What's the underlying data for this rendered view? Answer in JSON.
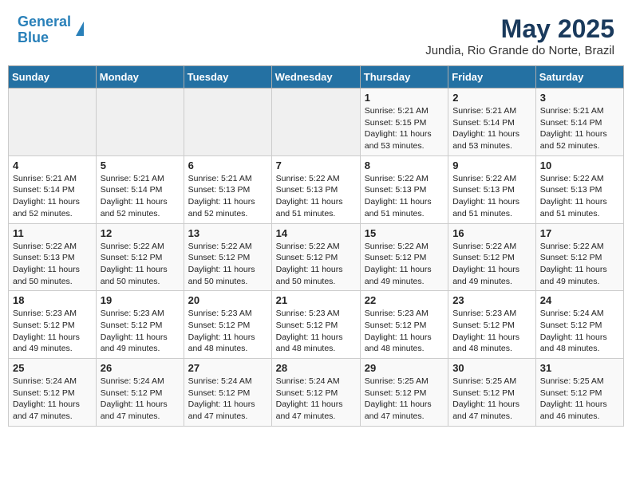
{
  "header": {
    "logo_line1": "General",
    "logo_line2": "Blue",
    "title": "May 2025",
    "subtitle": "Jundia, Rio Grande do Norte, Brazil"
  },
  "calendar": {
    "days_of_week": [
      "Sunday",
      "Monday",
      "Tuesday",
      "Wednesday",
      "Thursday",
      "Friday",
      "Saturday"
    ],
    "weeks": [
      [
        {
          "day": "",
          "info": ""
        },
        {
          "day": "",
          "info": ""
        },
        {
          "day": "",
          "info": ""
        },
        {
          "day": "",
          "info": ""
        },
        {
          "day": "1",
          "info": "Sunrise: 5:21 AM\nSunset: 5:15 PM\nDaylight: 11 hours\nand 53 minutes."
        },
        {
          "day": "2",
          "info": "Sunrise: 5:21 AM\nSunset: 5:14 PM\nDaylight: 11 hours\nand 53 minutes."
        },
        {
          "day": "3",
          "info": "Sunrise: 5:21 AM\nSunset: 5:14 PM\nDaylight: 11 hours\nand 52 minutes."
        }
      ],
      [
        {
          "day": "4",
          "info": "Sunrise: 5:21 AM\nSunset: 5:14 PM\nDaylight: 11 hours\nand 52 minutes."
        },
        {
          "day": "5",
          "info": "Sunrise: 5:21 AM\nSunset: 5:14 PM\nDaylight: 11 hours\nand 52 minutes."
        },
        {
          "day": "6",
          "info": "Sunrise: 5:21 AM\nSunset: 5:13 PM\nDaylight: 11 hours\nand 52 minutes."
        },
        {
          "day": "7",
          "info": "Sunrise: 5:22 AM\nSunset: 5:13 PM\nDaylight: 11 hours\nand 51 minutes."
        },
        {
          "day": "8",
          "info": "Sunrise: 5:22 AM\nSunset: 5:13 PM\nDaylight: 11 hours\nand 51 minutes."
        },
        {
          "day": "9",
          "info": "Sunrise: 5:22 AM\nSunset: 5:13 PM\nDaylight: 11 hours\nand 51 minutes."
        },
        {
          "day": "10",
          "info": "Sunrise: 5:22 AM\nSunset: 5:13 PM\nDaylight: 11 hours\nand 51 minutes."
        }
      ],
      [
        {
          "day": "11",
          "info": "Sunrise: 5:22 AM\nSunset: 5:13 PM\nDaylight: 11 hours\nand 50 minutes."
        },
        {
          "day": "12",
          "info": "Sunrise: 5:22 AM\nSunset: 5:12 PM\nDaylight: 11 hours\nand 50 minutes."
        },
        {
          "day": "13",
          "info": "Sunrise: 5:22 AM\nSunset: 5:12 PM\nDaylight: 11 hours\nand 50 minutes."
        },
        {
          "day": "14",
          "info": "Sunrise: 5:22 AM\nSunset: 5:12 PM\nDaylight: 11 hours\nand 50 minutes."
        },
        {
          "day": "15",
          "info": "Sunrise: 5:22 AM\nSunset: 5:12 PM\nDaylight: 11 hours\nand 49 minutes."
        },
        {
          "day": "16",
          "info": "Sunrise: 5:22 AM\nSunset: 5:12 PM\nDaylight: 11 hours\nand 49 minutes."
        },
        {
          "day": "17",
          "info": "Sunrise: 5:22 AM\nSunset: 5:12 PM\nDaylight: 11 hours\nand 49 minutes."
        }
      ],
      [
        {
          "day": "18",
          "info": "Sunrise: 5:23 AM\nSunset: 5:12 PM\nDaylight: 11 hours\nand 49 minutes."
        },
        {
          "day": "19",
          "info": "Sunrise: 5:23 AM\nSunset: 5:12 PM\nDaylight: 11 hours\nand 49 minutes."
        },
        {
          "day": "20",
          "info": "Sunrise: 5:23 AM\nSunset: 5:12 PM\nDaylight: 11 hours\nand 48 minutes."
        },
        {
          "day": "21",
          "info": "Sunrise: 5:23 AM\nSunset: 5:12 PM\nDaylight: 11 hours\nand 48 minutes."
        },
        {
          "day": "22",
          "info": "Sunrise: 5:23 AM\nSunset: 5:12 PM\nDaylight: 11 hours\nand 48 minutes."
        },
        {
          "day": "23",
          "info": "Sunrise: 5:23 AM\nSunset: 5:12 PM\nDaylight: 11 hours\nand 48 minutes."
        },
        {
          "day": "24",
          "info": "Sunrise: 5:24 AM\nSunset: 5:12 PM\nDaylight: 11 hours\nand 48 minutes."
        }
      ],
      [
        {
          "day": "25",
          "info": "Sunrise: 5:24 AM\nSunset: 5:12 PM\nDaylight: 11 hours\nand 47 minutes."
        },
        {
          "day": "26",
          "info": "Sunrise: 5:24 AM\nSunset: 5:12 PM\nDaylight: 11 hours\nand 47 minutes."
        },
        {
          "day": "27",
          "info": "Sunrise: 5:24 AM\nSunset: 5:12 PM\nDaylight: 11 hours\nand 47 minutes."
        },
        {
          "day": "28",
          "info": "Sunrise: 5:24 AM\nSunset: 5:12 PM\nDaylight: 11 hours\nand 47 minutes."
        },
        {
          "day": "29",
          "info": "Sunrise: 5:25 AM\nSunset: 5:12 PM\nDaylight: 11 hours\nand 47 minutes."
        },
        {
          "day": "30",
          "info": "Sunrise: 5:25 AM\nSunset: 5:12 PM\nDaylight: 11 hours\nand 47 minutes."
        },
        {
          "day": "31",
          "info": "Sunrise: 5:25 AM\nSunset: 5:12 PM\nDaylight: 11 hours\nand 46 minutes."
        }
      ]
    ]
  }
}
